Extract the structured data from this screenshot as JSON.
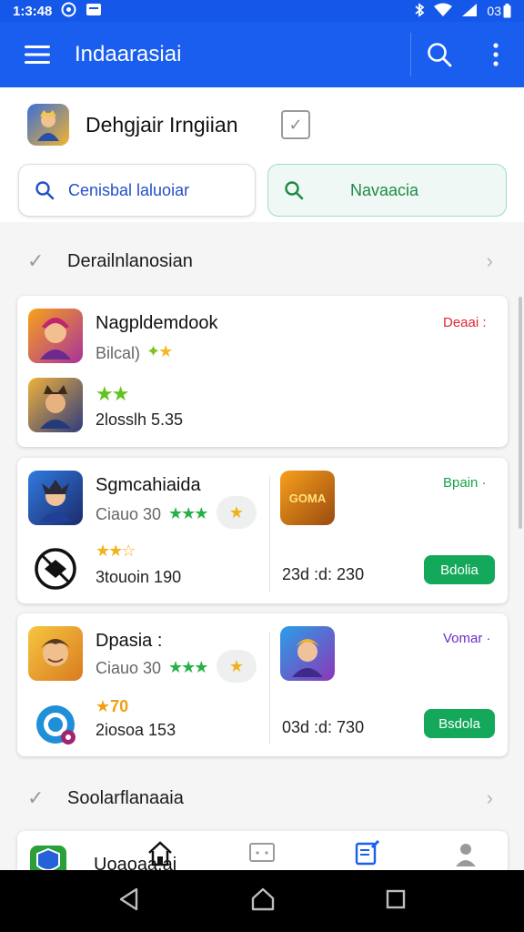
{
  "status_bar": {
    "time": "1:3:48",
    "battery_label": "03",
    "icons": [
      "media-icon",
      "notification-icon",
      "bluetooth-icon",
      "wifi-icon",
      "signal-icon",
      "battery-icon"
    ]
  },
  "app_bar": {
    "title": "Indaarasiai",
    "color": "#1a5ef0"
  },
  "profile": {
    "name": "Dehgjair Irngiian"
  },
  "search": {
    "left_label": "Cenisbal laluoiar",
    "right_label": "Navaacia"
  },
  "sections": [
    {
      "title": "Derailnlanosian"
    },
    {
      "title": "Soolarflanaaia"
    }
  ],
  "cards": [
    {
      "name": "Nagpldemdook",
      "sub": "Bilcal)",
      "stat": "2losslh 5.35",
      "tag": "Deaai :",
      "tag_color": "#e0242f"
    },
    {
      "name": "Sgmcahiaida",
      "sub": "Ciauo 30",
      "stat": "3touoin 190",
      "right_stat": "23d :d: 230",
      "tag": "Bpain ·",
      "tag_color": "#17a34a",
      "button": "Bdolia",
      "right_thumb_text": "GOMA"
    },
    {
      "name": "Dpasia :",
      "sub": "Ciauo 30",
      "stat": "2iosoa 153",
      "right_stat": "03d :d: 730",
      "rating": "70",
      "tag": "Vomar ·",
      "tag_color": "#6a2fc8",
      "button": "Bsdola"
    }
  ],
  "bottom_partial": {
    "label": "Uoaoaa.ai"
  }
}
